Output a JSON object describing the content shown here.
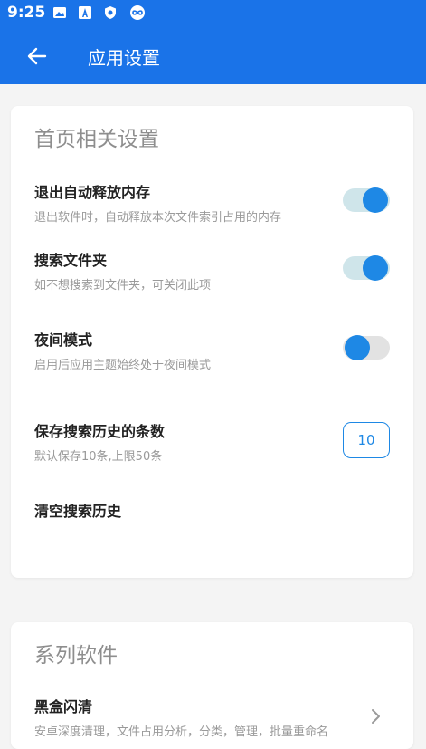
{
  "status_bar": {
    "time": "9:25",
    "icons": [
      "image-icon",
      "a-box-icon",
      "shield-icon",
      "infinity-icon"
    ]
  },
  "app_bar": {
    "back_icon": "arrow-left-icon",
    "title": "应用设置"
  },
  "home_settings": {
    "section_title": "首页相关设置",
    "auto_release": {
      "title": "退出自动释放内存",
      "subtitle": "退出软件时，自动释放本次文件索引占用的内存",
      "enabled": true
    },
    "search_folders": {
      "title": "搜索文件夹",
      "subtitle": "如不想搜索到文件夹，可关闭此项",
      "enabled": true
    },
    "night_mode": {
      "title": "夜间模式",
      "subtitle": "启用后应用主题始终处于夜间模式",
      "enabled": false
    },
    "history_count": {
      "title": "保存搜索历史的条数",
      "subtitle": "默认保存10条,上限50条",
      "value": "10"
    },
    "clear_history": {
      "title": "清空搜索历史"
    }
  },
  "series_software": {
    "section_title": "系列软件",
    "items": [
      {
        "title": "黑盒闪清",
        "subtitle": "安卓深度清理，文件占用分析，分类，管理，批量重命名"
      }
    ]
  },
  "colors": {
    "primary": "#1a73e8",
    "accent": "#1e88e5",
    "switch_track_on": "#cfe5ea",
    "switch_track_off": "#e2e2e2"
  }
}
